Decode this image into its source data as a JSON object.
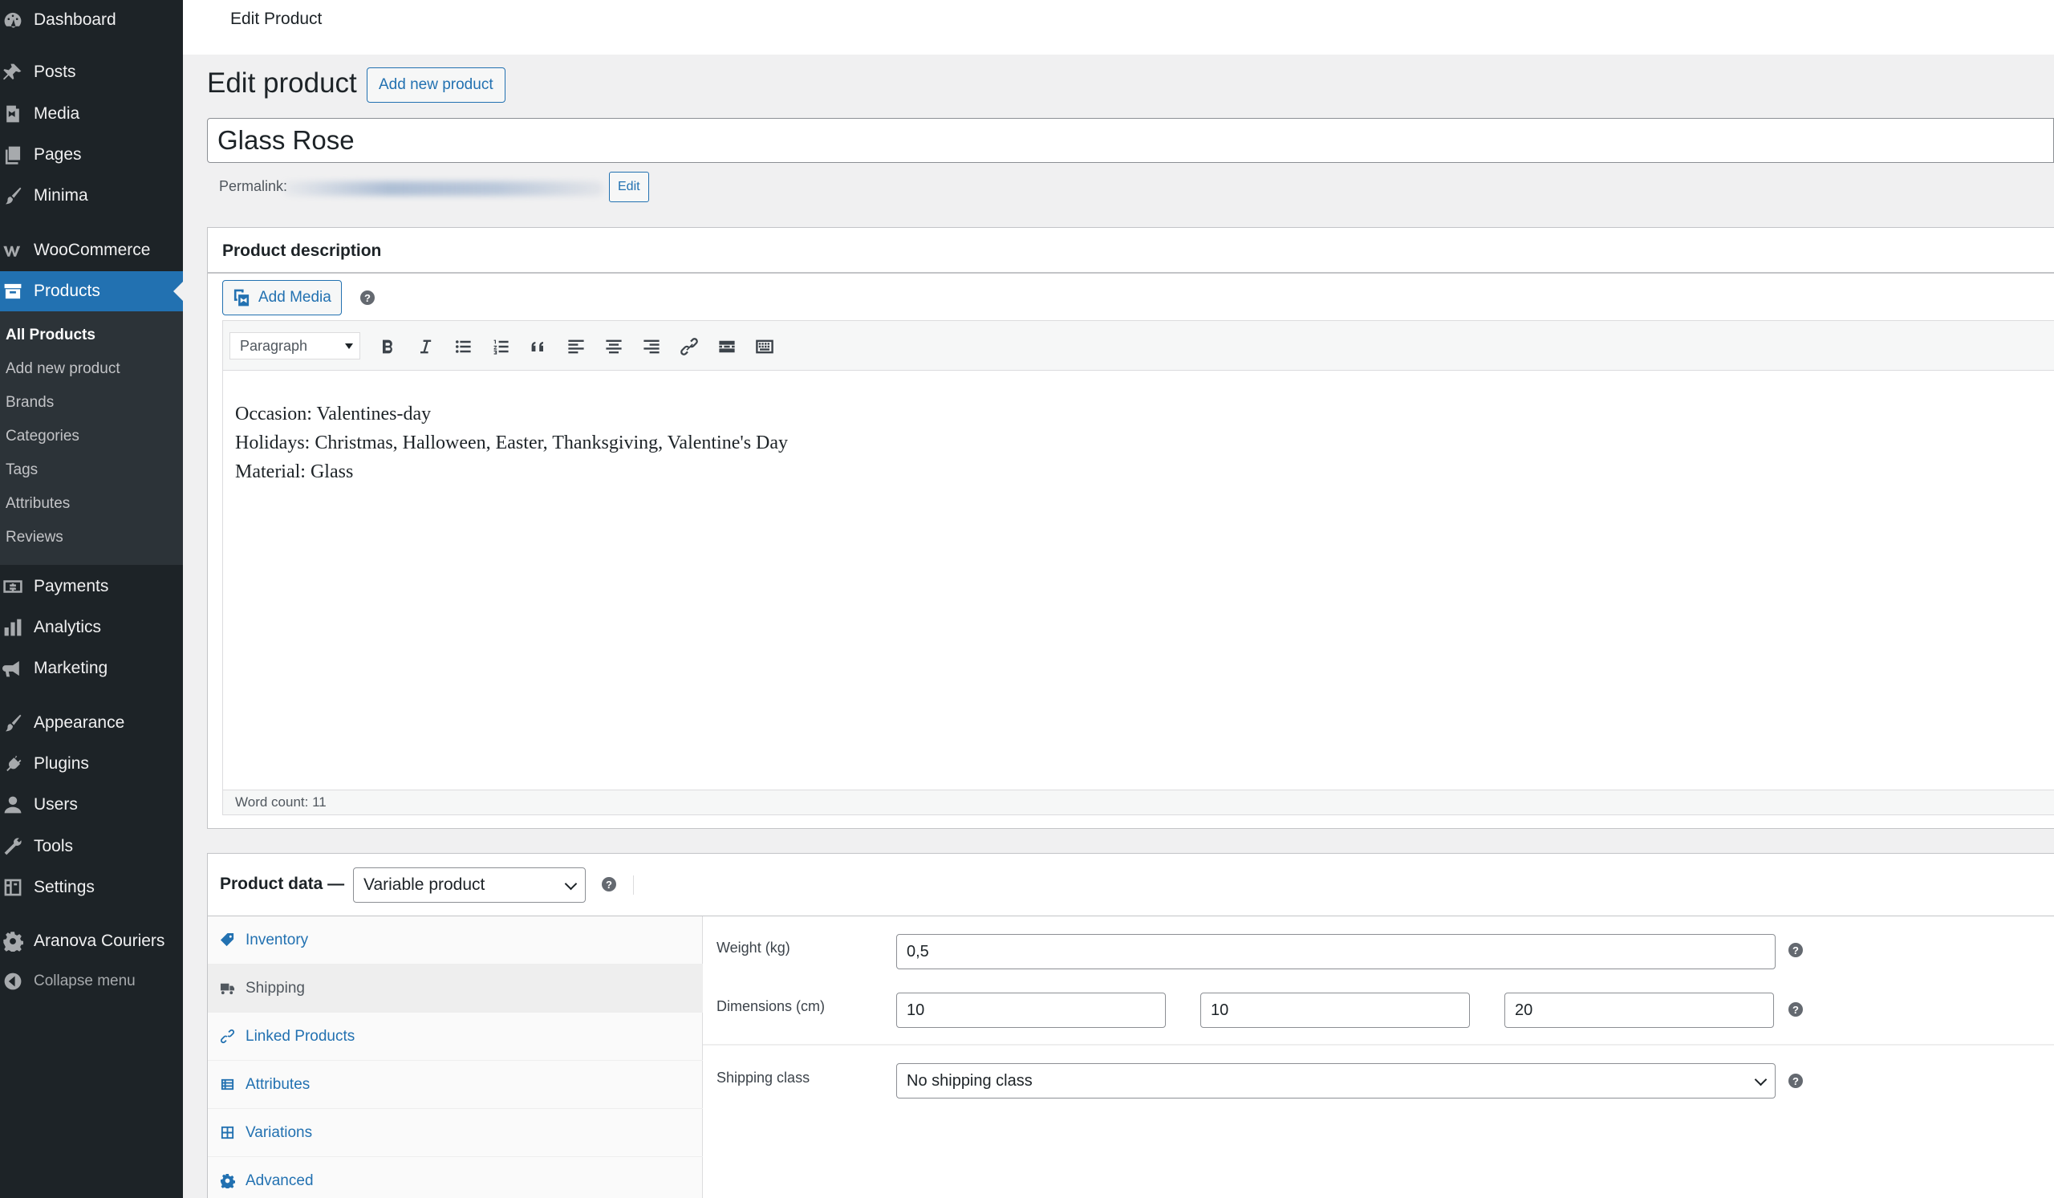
{
  "sidebar": {
    "items": [
      {
        "label": "Dashboard",
        "icon": "dashboard-icon"
      },
      {
        "label": "Posts",
        "icon": "pushpin-icon"
      },
      {
        "label": "Media",
        "icon": "media-icon"
      },
      {
        "label": "Pages",
        "icon": "pages-icon"
      },
      {
        "label": "Minima",
        "icon": "brush-icon"
      },
      {
        "label": "WooCommerce",
        "icon": "woocommerce-icon"
      },
      {
        "label": "Products",
        "icon": "archive-box-icon"
      },
      {
        "label": "Payments",
        "icon": "dollar-icon"
      },
      {
        "label": "Analytics",
        "icon": "bar-chart-icon"
      },
      {
        "label": "Marketing",
        "icon": "megaphone-icon"
      },
      {
        "label": "Appearance",
        "icon": "brush-icon"
      },
      {
        "label": "Plugins",
        "icon": "plug-icon"
      },
      {
        "label": "Users",
        "icon": "user-icon"
      },
      {
        "label": "Tools",
        "icon": "wrench-icon"
      },
      {
        "label": "Settings",
        "icon": "settings-icon"
      },
      {
        "label": "Aranova Couriers",
        "icon": "gear-icon"
      },
      {
        "label": "Collapse menu",
        "icon": "collapse-icon"
      }
    ],
    "submenu": [
      "All Products",
      "Add new product",
      "Brands",
      "Categories",
      "Tags",
      "Attributes",
      "Reviews"
    ]
  },
  "topbar": {
    "title": "Edit Product"
  },
  "heading": {
    "title": "Edit product",
    "add_new": "Add new product"
  },
  "product": {
    "title": "Glass Rose",
    "permalink_label": "Permalink:",
    "permalink_edit": "Edit"
  },
  "description": {
    "title": "Product description",
    "add_media": "Add Media",
    "format": "Paragraph",
    "lines": [
      "Occasion: Valentines-day",
      "Holidays: Christmas, Halloween, Easter, Thanksgiving, Valentine's Day",
      "Material: Glass"
    ],
    "word_count": "Word count: 11"
  },
  "product_data": {
    "title": "Product data —",
    "type": "Variable product",
    "tabs": [
      "Inventory",
      "Shipping",
      "Linked Products",
      "Attributes",
      "Variations",
      "Advanced"
    ],
    "active_tab": "Shipping",
    "shipping": {
      "weight_label": "Weight (kg)",
      "weight": "0,5",
      "dimensions_label": "Dimensions (cm)",
      "length": "10",
      "width": "10",
      "height": "20",
      "class_label": "Shipping class",
      "class": "No shipping class"
    }
  },
  "colors": {
    "accent": "#2271b1",
    "sidebar": "#1d2327",
    "submenu": "#2c3338"
  }
}
